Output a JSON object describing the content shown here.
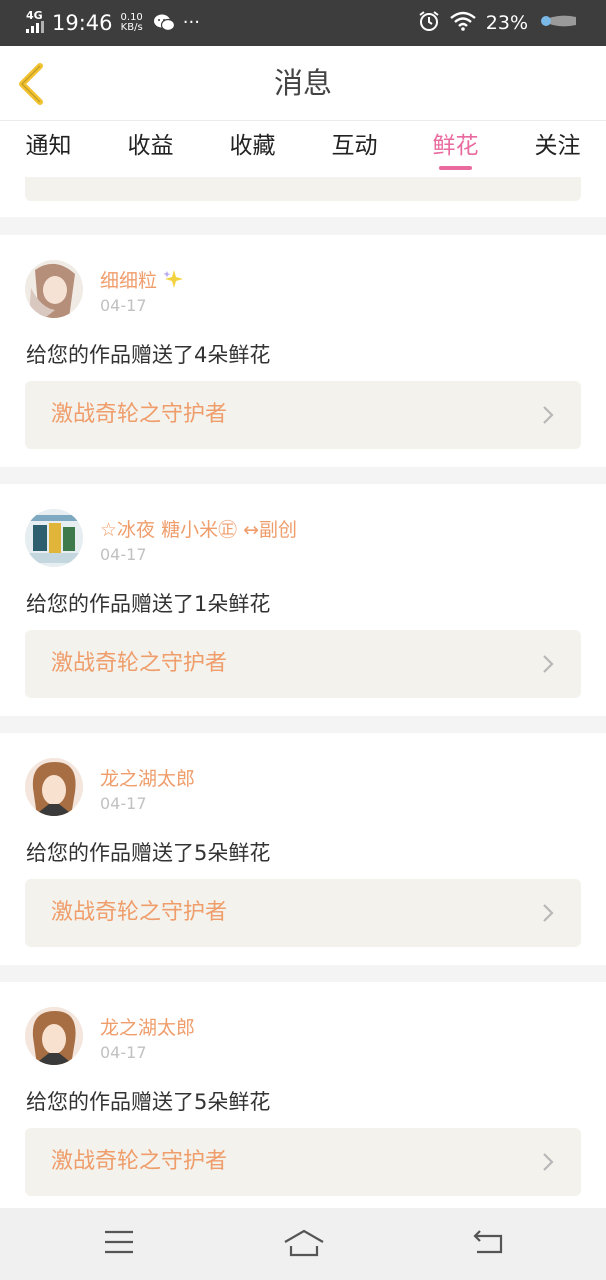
{
  "status_bar": {
    "network": "4G",
    "time": "19:46",
    "speed_value": "0.10",
    "speed_unit": "KB/s",
    "more": "···",
    "battery": "23%"
  },
  "header": {
    "title": "消息"
  },
  "tabs": [
    {
      "label": "通知"
    },
    {
      "label": "收益"
    },
    {
      "label": "收藏"
    },
    {
      "label": "互动"
    },
    {
      "label": "鲜花",
      "active": true
    },
    {
      "label": "关注"
    }
  ],
  "messages": [
    {
      "user": "细细粒",
      "badge": "sparkle-icon",
      "date": "04-17",
      "text": "给您的作品赠送了4朵鲜花",
      "work": "激战奇轮之守护者"
    },
    {
      "user": "☆冰夜 糖小米㊣ ↔副创",
      "date": "04-17",
      "text": "给您的作品赠送了1朵鲜花",
      "work": "激战奇轮之守护者"
    },
    {
      "user": "龙之湖太郎",
      "date": "04-17",
      "text": "给您的作品赠送了5朵鲜花",
      "work": "激战奇轮之守护者"
    },
    {
      "user": "龙之湖太郎",
      "date": "04-17",
      "text": "给您的作品赠送了5朵鲜花",
      "work": "激战奇轮之守护者"
    }
  ],
  "colors": {
    "accent": "#e86a9e",
    "username": "#ef9d6b",
    "link_bg": "#f3f2ec",
    "back_arrow": "#f2c22e"
  }
}
